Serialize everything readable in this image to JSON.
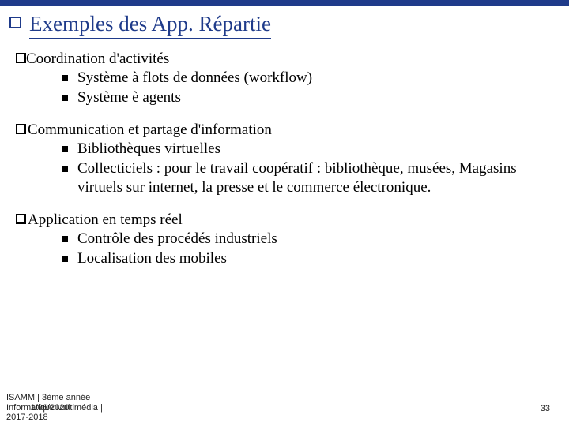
{
  "title": "Exemples des App. Répartie",
  "sections": [
    {
      "heading": "Coordination d'activités",
      "nospace": true,
      "items": [
        "Système à flots de données (workflow)",
        "Système è agents"
      ]
    },
    {
      "heading": " Communication et partage d'information",
      "nospace": false,
      "items": [
        "Bibliothèques virtuelles",
        "Collecticiels : pour le travail coopératif : bibliothèque, musées, Magasins virtuels sur internet, la presse et le commerce électronique."
      ]
    },
    {
      "heading": " Application en temps réel",
      "nospace": false,
      "items": [
        "Contrôle des procédés industriels",
        "Localisation des mobiles"
      ]
    }
  ],
  "footer": {
    "left_lines": [
      "ISAMM | 3ème année",
      "Informatique Multimédia |",
      "  1/06/2020",
      "2017-2018"
    ],
    "left_combined": "ISAMM | 3ème année\nInformatique Multimédia |\n2017-2018",
    "date_overlay": "1/06/2020",
    "page": "33"
  }
}
